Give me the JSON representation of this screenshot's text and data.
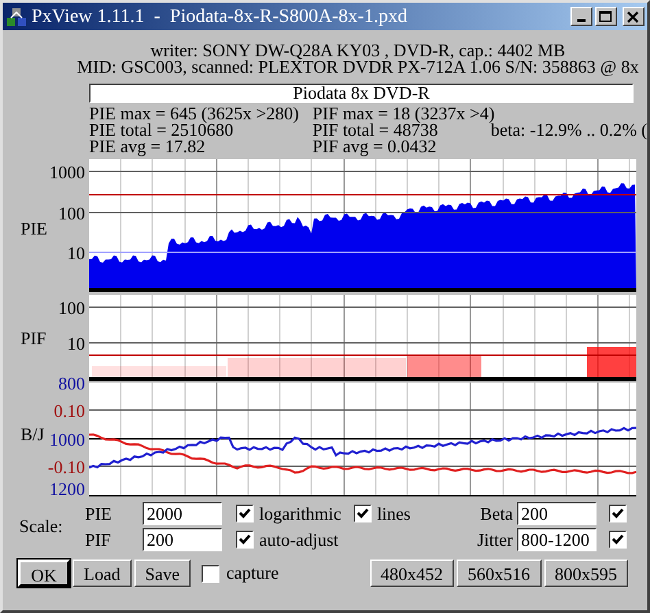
{
  "window": {
    "title": "PxView 1.11.1  -  Piodata-8x-R-S800A-8x-1.pxd"
  },
  "info": {
    "writer": "writer: SONY DW-Q28A KY03 , DVD-R, cap.: 4402 MB",
    "scanned": "MID: GSC003, scanned: PLEXTOR DVDR PX-712A 1.06 S/N: 358863 @ 8x",
    "disc_label": "Piodata 8x DVD-R"
  },
  "stats": {
    "pie": [
      "PIE max = 645 (3625x >280)",
      "PIE total = 2510680",
      "PIE avg = 17.82"
    ],
    "pif": [
      "PIF max = 18 (3237x >4)",
      "PIF total = 48738",
      "PIF avg = 0.0432"
    ],
    "beta": "beta: -12.9% .. 0.2% ("
  },
  "graphs": [
    {
      "kind": "pie",
      "label": "PIE",
      "ticks": [
        {
          "text": "1000",
          "color": "#000000"
        },
        {
          "text": "100",
          "color": "#000000"
        },
        {
          "text": "10",
          "color": "#000000"
        }
      ]
    },
    {
      "kind": "pif",
      "label": "PIF",
      "ticks": [
        {
          "text": "100",
          "color": "#000000"
        },
        {
          "text": "10",
          "color": "#000000"
        }
      ]
    },
    {
      "kind": "bj",
      "label": "B/J",
      "ticks": [
        {
          "text": "800",
          "color": "#1010a0"
        },
        {
          "text": "0.10",
          "color": "#a01010"
        },
        {
          "text": "1000",
          "color": "#1010a0"
        },
        {
          "text": "-0.10",
          "color": "#a01010"
        },
        {
          "text": "1200",
          "color": "#1010a0"
        }
      ]
    }
  ],
  "scale": {
    "label": "Scale:",
    "rows": [
      {
        "name": "PIE",
        "value": "2000",
        "options": [
          {
            "label": "logarithmic",
            "checked": true
          },
          {
            "label": "lines",
            "checked": true
          }
        ],
        "right_name": "Beta",
        "right_value": "200",
        "right_checked": true
      },
      {
        "name": "PIF",
        "value": "200",
        "options": [
          {
            "label": "auto-adjust",
            "checked": true
          }
        ],
        "right_name": "Jitter",
        "right_value": "800-1200",
        "right_checked": true
      }
    ]
  },
  "buttons": [
    {
      "label": "OK",
      "default": true
    },
    {
      "label": "Load",
      "default": false
    },
    {
      "label": "Save",
      "default": false
    }
  ],
  "capture": {
    "label": "capture",
    "checked": false
  },
  "size_buttons": [
    "480x452",
    "560x516",
    "800x595"
  ]
}
